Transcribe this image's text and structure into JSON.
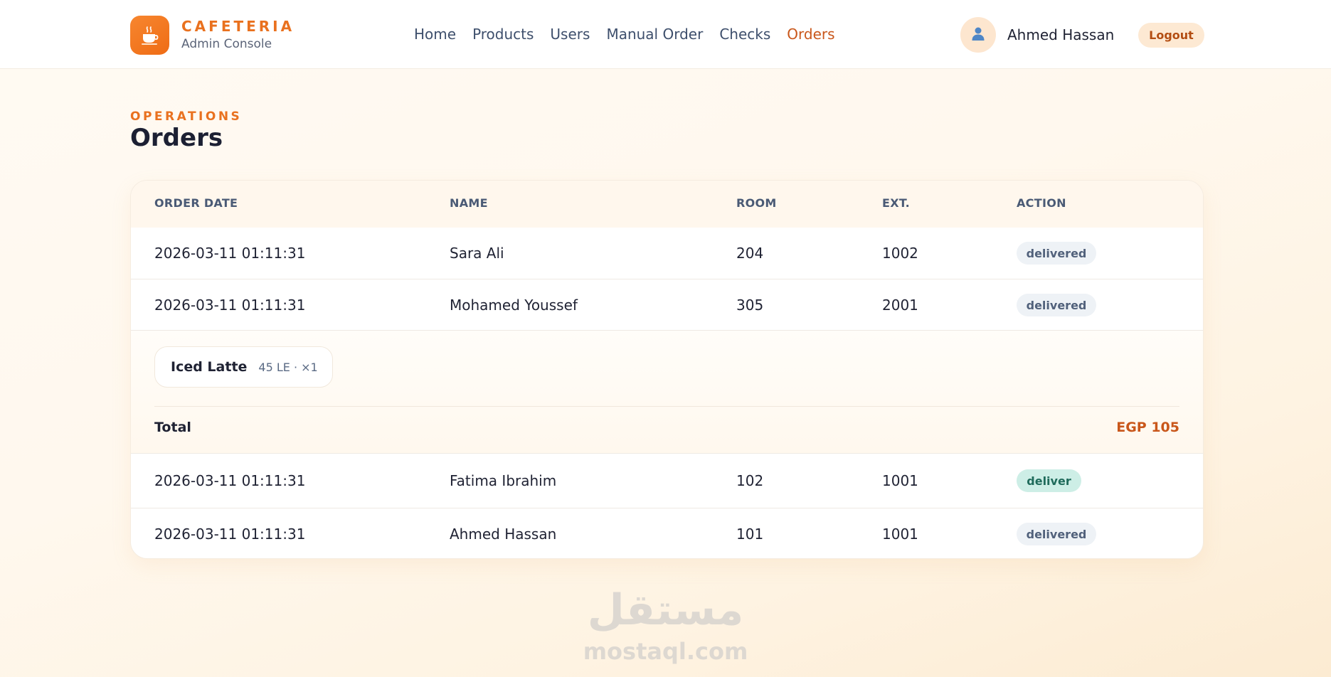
{
  "brand": {
    "name": "CAFETERIA",
    "subtitle": "Admin Console",
    "logo_icon": "coffee-cup-icon",
    "accent_color": "#ef6c15"
  },
  "nav": {
    "items": [
      {
        "label": "Home",
        "active": false
      },
      {
        "label": "Products",
        "active": false
      },
      {
        "label": "Users",
        "active": false
      },
      {
        "label": "Manual Order",
        "active": false
      },
      {
        "label": "Checks",
        "active": false
      },
      {
        "label": "Orders",
        "active": true
      }
    ],
    "active_color": "#c9571b"
  },
  "user": {
    "name": "Ahmed Hassan",
    "avatar_icon": "user-icon",
    "logout_label": "Logout"
  },
  "page": {
    "eyebrow": "OPERATIONS",
    "title": "Orders"
  },
  "table": {
    "columns": [
      "ORDER DATE",
      "NAME",
      "ROOM",
      "EXT.",
      "ACTION"
    ],
    "rows": [
      {
        "date": "2026-03-11 01:11:31",
        "name": "Sara Ali",
        "room": "204",
        "ext": "1002",
        "action": "delivered",
        "action_state": "done"
      },
      {
        "date": "2026-03-11 01:11:31",
        "name": "Mohamed Youssef",
        "room": "305",
        "ext": "2001",
        "action": "delivered",
        "action_state": "done"
      },
      {
        "date": "2026-03-11 01:11:31",
        "name": "Fatima Ibrahim",
        "room": "102",
        "ext": "1001",
        "action": "deliver",
        "action_state": "pending"
      },
      {
        "date": "2026-03-11 01:11:31",
        "name": "Ahmed Hassan",
        "room": "101",
        "ext": "1001",
        "action": "delivered",
        "action_state": "done"
      }
    ],
    "expanded_details": {
      "after_row": 1,
      "items": [
        {
          "name": "Iced Latte",
          "meta": "45 LE · ×1"
        }
      ],
      "total_label": "Total",
      "total_value": "EGP 105"
    }
  },
  "watermark": {
    "arabic": "مستقل",
    "latin": "mostaql.com"
  }
}
